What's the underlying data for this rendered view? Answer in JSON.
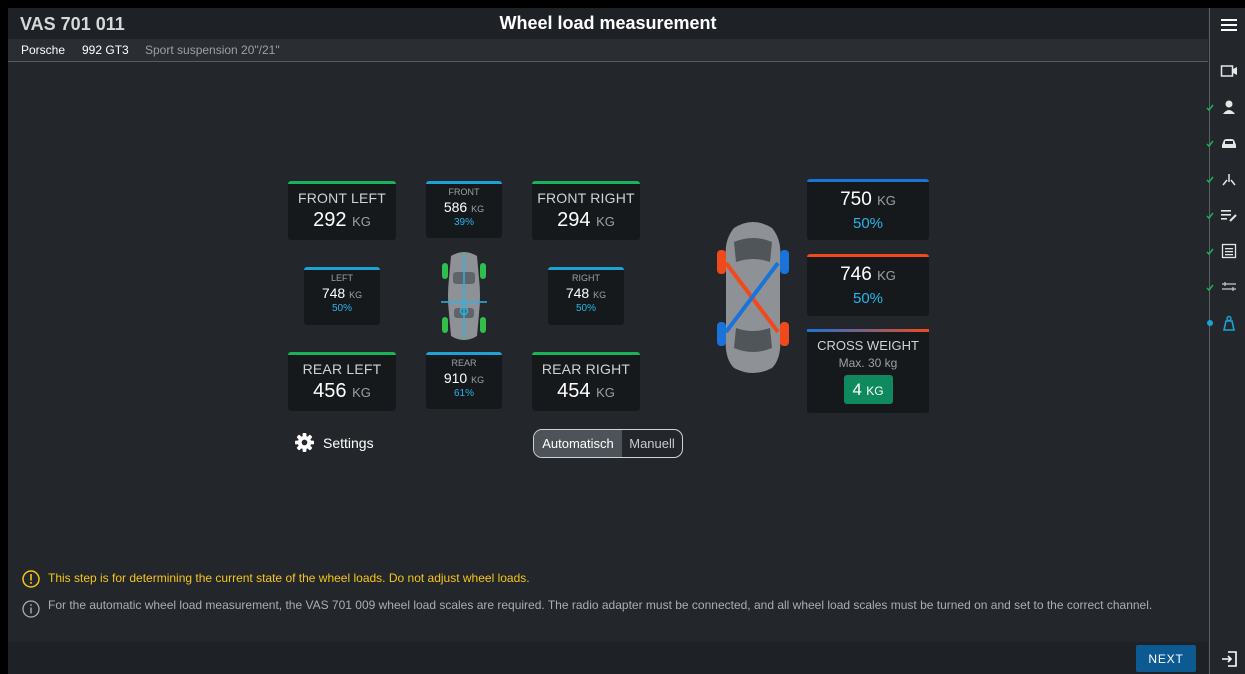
{
  "header": {
    "app_name": "VAS 701 011",
    "title": "Wheel load measurement"
  },
  "vehicle": {
    "brand": "Porsche",
    "model": "992 GT3",
    "suspension": "Sport suspension 20\"/21\""
  },
  "wheels": {
    "front_left": {
      "label": "FRONT LEFT",
      "value": "292",
      "unit": "KG"
    },
    "front_right": {
      "label": "FRONT RIGHT",
      "value": "294",
      "unit": "KG"
    },
    "rear_left": {
      "label": "REAR LEFT",
      "value": "456",
      "unit": "KG"
    },
    "rear_right": {
      "label": "REAR RIGHT",
      "value": "454",
      "unit": "KG"
    }
  },
  "axles": {
    "front": {
      "label": "FRONT",
      "value": "586",
      "unit": "KG",
      "pct": "39%"
    },
    "rear": {
      "label": "REAR",
      "value": "910",
      "unit": "KG",
      "pct": "61%"
    },
    "left": {
      "label": "LEFT",
      "value": "748",
      "unit": "KG",
      "pct": "50%"
    },
    "right": {
      "label": "RIGHT",
      "value": "748",
      "unit": "KG",
      "pct": "50%"
    }
  },
  "diagonals": {
    "blue": {
      "value": "750",
      "unit": "KG",
      "pct": "50%",
      "color": "#1a73d9"
    },
    "red": {
      "value": "746",
      "unit": "KG",
      "pct": "50%",
      "color": "#f04a1c"
    }
  },
  "cross_weight": {
    "label": "CROSS WEIGHT",
    "max": "Max. 30 kg",
    "value": "4",
    "unit": "KG",
    "badge_color": "#0f8a5f"
  },
  "settings": {
    "label": "Settings"
  },
  "mode": {
    "auto": "Automatisch",
    "manual": "Manuell",
    "selected": "Automatisch"
  },
  "messages": {
    "warning": "This step is for determining the current state of the wheel loads. Do not adjust wheel loads.",
    "info": "For the automatic wheel load measurement, the VAS 701 009 wheel load scales are required. The radio adapter must be connected, and all wheel load scales must be turned on and set to the correct channel."
  },
  "footer": {
    "next_label": "NEXT"
  },
  "sidebar": {
    "icons": [
      "menu-icon",
      "camera-icon",
      "person-icon",
      "car-icon",
      "hoist-icon",
      "edit-list-icon",
      "checklist-icon",
      "alignment-icon",
      "weight-icon",
      "exit-icon"
    ]
  },
  "colors": {
    "accent_green": "#19b35a",
    "accent_blue": "#1aa3d4",
    "percent": "#27b5e8",
    "warning": "#f5c518",
    "button": "#0d5a92"
  }
}
